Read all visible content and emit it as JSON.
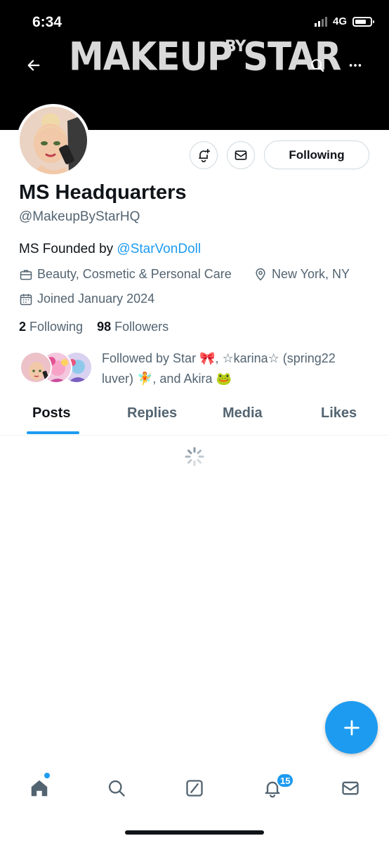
{
  "status_bar": {
    "time": "6:34",
    "network": "4G"
  },
  "banner": {
    "brand_main": "MAKEUP",
    "brand_by": "BY",
    "brand_star": "STAR"
  },
  "profile": {
    "name": "MS Headquarters",
    "handle": "@MakeupByStarHQ",
    "bio_prefix": "MS Founded by ",
    "bio_mention": "@StarVonDoll",
    "category": "Beauty, Cosmetic & Personal Care",
    "location": "New York, NY",
    "joined": "Joined January 2024",
    "following_count": "2",
    "following_label": "Following",
    "followers_count": "98",
    "followers_label": "Followers",
    "followed_by_line1": "Followed by Star 🎀, ☆karina☆ (spring22",
    "followed_by_line2": "luver) 🧚, and Akira 🐸"
  },
  "actions": {
    "following_button": "Following"
  },
  "tabs": [
    {
      "label": "Posts",
      "active": true
    },
    {
      "label": "Replies",
      "active": false
    },
    {
      "label": "Media",
      "active": false
    },
    {
      "label": "Likes",
      "active": false
    }
  ],
  "bottom_nav": {
    "notifications_badge": "15"
  },
  "colors": {
    "accent": "#1d9bf0",
    "text_primary": "#0f1419",
    "text_secondary": "#536471"
  }
}
